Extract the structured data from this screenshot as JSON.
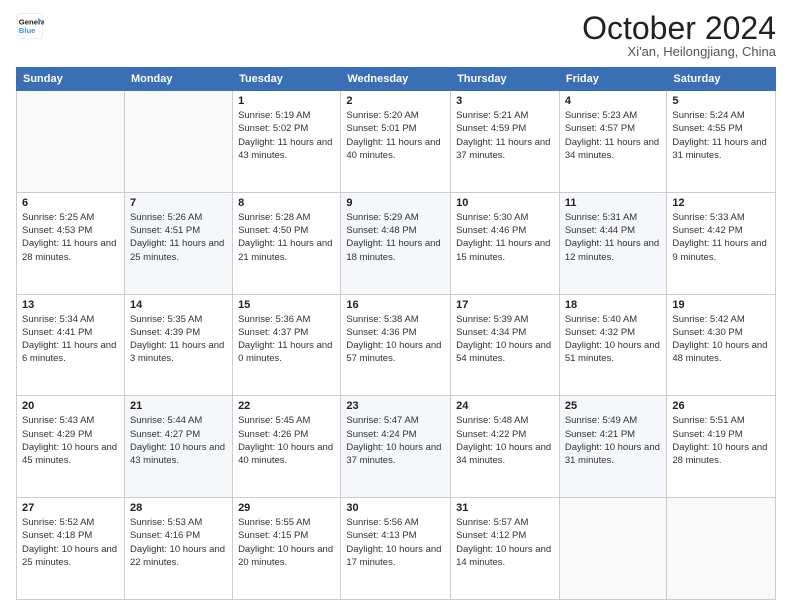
{
  "header": {
    "logo_line1": "General",
    "logo_line2": "Blue",
    "month": "October 2024",
    "location": "Xi'an, Heilongjiang, China"
  },
  "days_of_week": [
    "Sunday",
    "Monday",
    "Tuesday",
    "Wednesday",
    "Thursday",
    "Friday",
    "Saturday"
  ],
  "weeks": [
    [
      {
        "day": "",
        "info": ""
      },
      {
        "day": "",
        "info": ""
      },
      {
        "day": "1",
        "info": "Sunrise: 5:19 AM\nSunset: 5:02 PM\nDaylight: 11 hours and 43 minutes."
      },
      {
        "day": "2",
        "info": "Sunrise: 5:20 AM\nSunset: 5:01 PM\nDaylight: 11 hours and 40 minutes."
      },
      {
        "day": "3",
        "info": "Sunrise: 5:21 AM\nSunset: 4:59 PM\nDaylight: 11 hours and 37 minutes."
      },
      {
        "day": "4",
        "info": "Sunrise: 5:23 AM\nSunset: 4:57 PM\nDaylight: 11 hours and 34 minutes."
      },
      {
        "day": "5",
        "info": "Sunrise: 5:24 AM\nSunset: 4:55 PM\nDaylight: 11 hours and 31 minutes."
      }
    ],
    [
      {
        "day": "6",
        "info": "Sunrise: 5:25 AM\nSunset: 4:53 PM\nDaylight: 11 hours and 28 minutes."
      },
      {
        "day": "7",
        "info": "Sunrise: 5:26 AM\nSunset: 4:51 PM\nDaylight: 11 hours and 25 minutes."
      },
      {
        "day": "8",
        "info": "Sunrise: 5:28 AM\nSunset: 4:50 PM\nDaylight: 11 hours and 21 minutes."
      },
      {
        "day": "9",
        "info": "Sunrise: 5:29 AM\nSunset: 4:48 PM\nDaylight: 11 hours and 18 minutes."
      },
      {
        "day": "10",
        "info": "Sunrise: 5:30 AM\nSunset: 4:46 PM\nDaylight: 11 hours and 15 minutes."
      },
      {
        "day": "11",
        "info": "Sunrise: 5:31 AM\nSunset: 4:44 PM\nDaylight: 11 hours and 12 minutes."
      },
      {
        "day": "12",
        "info": "Sunrise: 5:33 AM\nSunset: 4:42 PM\nDaylight: 11 hours and 9 minutes."
      }
    ],
    [
      {
        "day": "13",
        "info": "Sunrise: 5:34 AM\nSunset: 4:41 PM\nDaylight: 11 hours and 6 minutes."
      },
      {
        "day": "14",
        "info": "Sunrise: 5:35 AM\nSunset: 4:39 PM\nDaylight: 11 hours and 3 minutes."
      },
      {
        "day": "15",
        "info": "Sunrise: 5:36 AM\nSunset: 4:37 PM\nDaylight: 11 hours and 0 minutes."
      },
      {
        "day": "16",
        "info": "Sunrise: 5:38 AM\nSunset: 4:36 PM\nDaylight: 10 hours and 57 minutes."
      },
      {
        "day": "17",
        "info": "Sunrise: 5:39 AM\nSunset: 4:34 PM\nDaylight: 10 hours and 54 minutes."
      },
      {
        "day": "18",
        "info": "Sunrise: 5:40 AM\nSunset: 4:32 PM\nDaylight: 10 hours and 51 minutes."
      },
      {
        "day": "19",
        "info": "Sunrise: 5:42 AM\nSunset: 4:30 PM\nDaylight: 10 hours and 48 minutes."
      }
    ],
    [
      {
        "day": "20",
        "info": "Sunrise: 5:43 AM\nSunset: 4:29 PM\nDaylight: 10 hours and 45 minutes."
      },
      {
        "day": "21",
        "info": "Sunrise: 5:44 AM\nSunset: 4:27 PM\nDaylight: 10 hours and 43 minutes."
      },
      {
        "day": "22",
        "info": "Sunrise: 5:45 AM\nSunset: 4:26 PM\nDaylight: 10 hours and 40 minutes."
      },
      {
        "day": "23",
        "info": "Sunrise: 5:47 AM\nSunset: 4:24 PM\nDaylight: 10 hours and 37 minutes."
      },
      {
        "day": "24",
        "info": "Sunrise: 5:48 AM\nSunset: 4:22 PM\nDaylight: 10 hours and 34 minutes."
      },
      {
        "day": "25",
        "info": "Sunrise: 5:49 AM\nSunset: 4:21 PM\nDaylight: 10 hours and 31 minutes."
      },
      {
        "day": "26",
        "info": "Sunrise: 5:51 AM\nSunset: 4:19 PM\nDaylight: 10 hours and 28 minutes."
      }
    ],
    [
      {
        "day": "27",
        "info": "Sunrise: 5:52 AM\nSunset: 4:18 PM\nDaylight: 10 hours and 25 minutes."
      },
      {
        "day": "28",
        "info": "Sunrise: 5:53 AM\nSunset: 4:16 PM\nDaylight: 10 hours and 22 minutes."
      },
      {
        "day": "29",
        "info": "Sunrise: 5:55 AM\nSunset: 4:15 PM\nDaylight: 10 hours and 20 minutes."
      },
      {
        "day": "30",
        "info": "Sunrise: 5:56 AM\nSunset: 4:13 PM\nDaylight: 10 hours and 17 minutes."
      },
      {
        "day": "31",
        "info": "Sunrise: 5:57 AM\nSunset: 4:12 PM\nDaylight: 10 hours and 14 minutes."
      },
      {
        "day": "",
        "info": ""
      },
      {
        "day": "",
        "info": ""
      }
    ]
  ]
}
